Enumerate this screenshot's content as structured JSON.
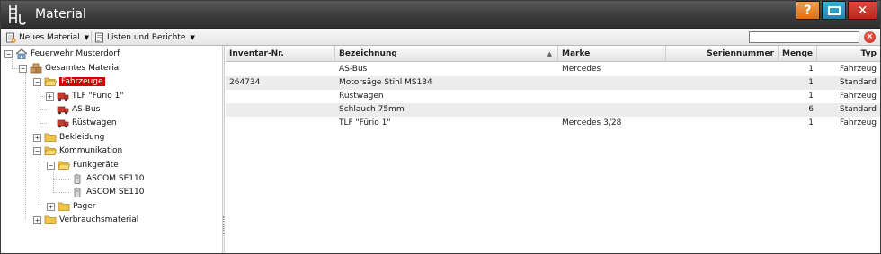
{
  "window": {
    "title": "Material",
    "icon": "ladder-icon",
    "buttons": {
      "help_label": "?",
      "close_label": "✕"
    },
    "colors": {
      "titlebar": "#3b3b3b",
      "help": "#e0802a",
      "maximize": "#2a9cc4",
      "close": "#cc3526",
      "selection": "#d40000"
    }
  },
  "toolbar": {
    "new_material_label": "Neues Material",
    "lists_reports_label": "Listen und Berichte",
    "search": {
      "value": "",
      "placeholder": ""
    }
  },
  "tree": {
    "root": "Feuerwehr Musterdorf",
    "all_material": "Gesamtes Material",
    "vehicles": "Fahrzeuge",
    "vehicle_items": [
      "TLF \"Fürio 1\"",
      "AS-Bus",
      "Rüstwagen"
    ],
    "clothing": "Bekleidung",
    "communication": "Kommunikation",
    "radios": "Funkgeräte",
    "radio_items": [
      "ASCOM SE110",
      "ASCOM SE110"
    ],
    "pager": "Pager",
    "consumables": "Verbrauchsmaterial"
  },
  "grid": {
    "columns": [
      "Inventar-Nr.",
      "Bezeichnung",
      "Marke",
      "Seriennummer",
      "Menge",
      "Typ"
    ],
    "sorted_column": "Bezeichnung",
    "rows": [
      {
        "inv": "",
        "name": "AS-Bus",
        "brand": "Mercedes",
        "serial": "",
        "qty": "1",
        "type": "Fahrzeug"
      },
      {
        "inv": "264734",
        "name": "Motorsäge Stihl MS134",
        "brand": "",
        "serial": "",
        "qty": "1",
        "type": "Standard"
      },
      {
        "inv": "",
        "name": "Rüstwagen",
        "brand": "",
        "serial": "",
        "qty": "1",
        "type": "Fahrzeug"
      },
      {
        "inv": "",
        "name": "Schlauch 75mm",
        "brand": "",
        "serial": "",
        "qty": "6",
        "type": "Standard"
      },
      {
        "inv": "",
        "name": "TLF \"Fürio 1\"",
        "brand": "Mercedes 3/28",
        "serial": "",
        "qty": "1",
        "type": "Fahrzeug"
      }
    ]
  }
}
